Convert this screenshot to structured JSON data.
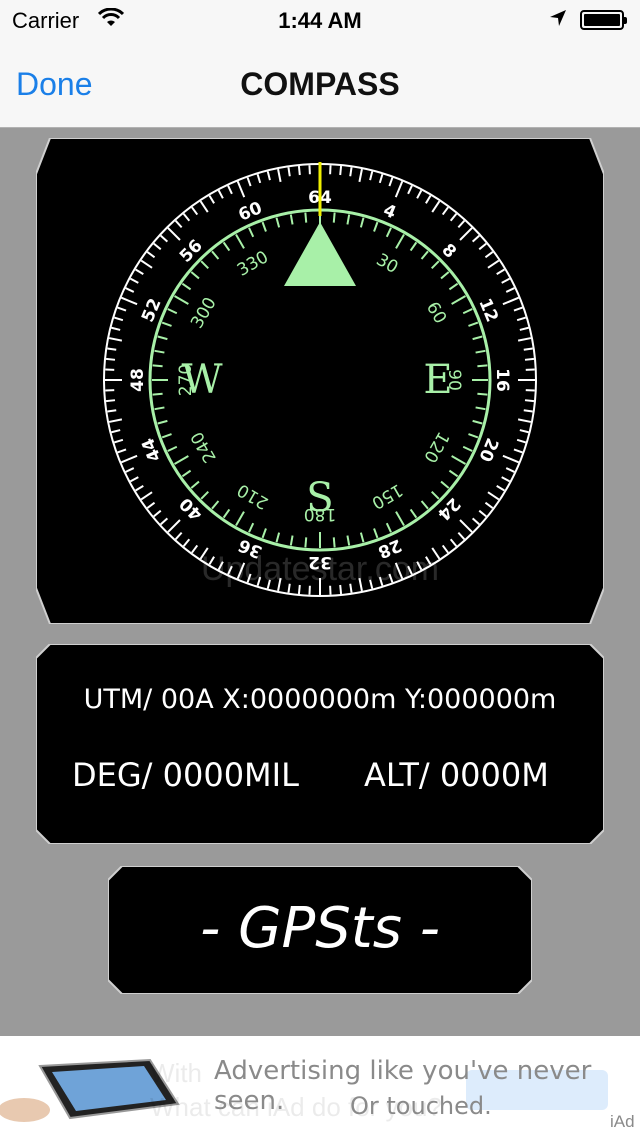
{
  "status_bar": {
    "carrier": "Carrier",
    "time": "1:44 AM"
  },
  "nav": {
    "done_label": "Done",
    "title": "COMPASS"
  },
  "compass": {
    "outer_labels": [
      "64",
      "4",
      "8",
      "12",
      "16",
      "20",
      "24",
      "28",
      "32",
      "36",
      "40",
      "44",
      "48",
      "52",
      "56",
      "60"
    ],
    "inner_labels": [
      "",
      "30",
      "60",
      "90",
      "120",
      "150",
      "180",
      "210",
      "240",
      "270",
      "300",
      "330"
    ],
    "cardinals": {
      "east": "E",
      "south": "S",
      "west": "W"
    },
    "watermark": "Updatestar.com"
  },
  "readout": {
    "utm": "UTM/ 00A X:0000000m Y:000000m",
    "deg": "DEG/ 0000MIL",
    "alt": "ALT/ 0000M"
  },
  "gps": {
    "status": "- GPSts -"
  },
  "ad": {
    "line1": "Advertising like you've never seen.",
    "line2": "Or touched.",
    "ghost1": "With",
    "ghost2": "What can iAd do for you?",
    "badge": "iAd"
  },
  "colors": {
    "accent": "#1a7fe8",
    "dial_green": "#a8f0a8",
    "needle_yellow": "#f0f000",
    "panel_bg": "#000000",
    "screen_bg": "#9a9a9a"
  },
  "icons": {
    "wifi": "wifi-icon",
    "location": "location-arrow-icon",
    "battery": "battery-icon"
  }
}
